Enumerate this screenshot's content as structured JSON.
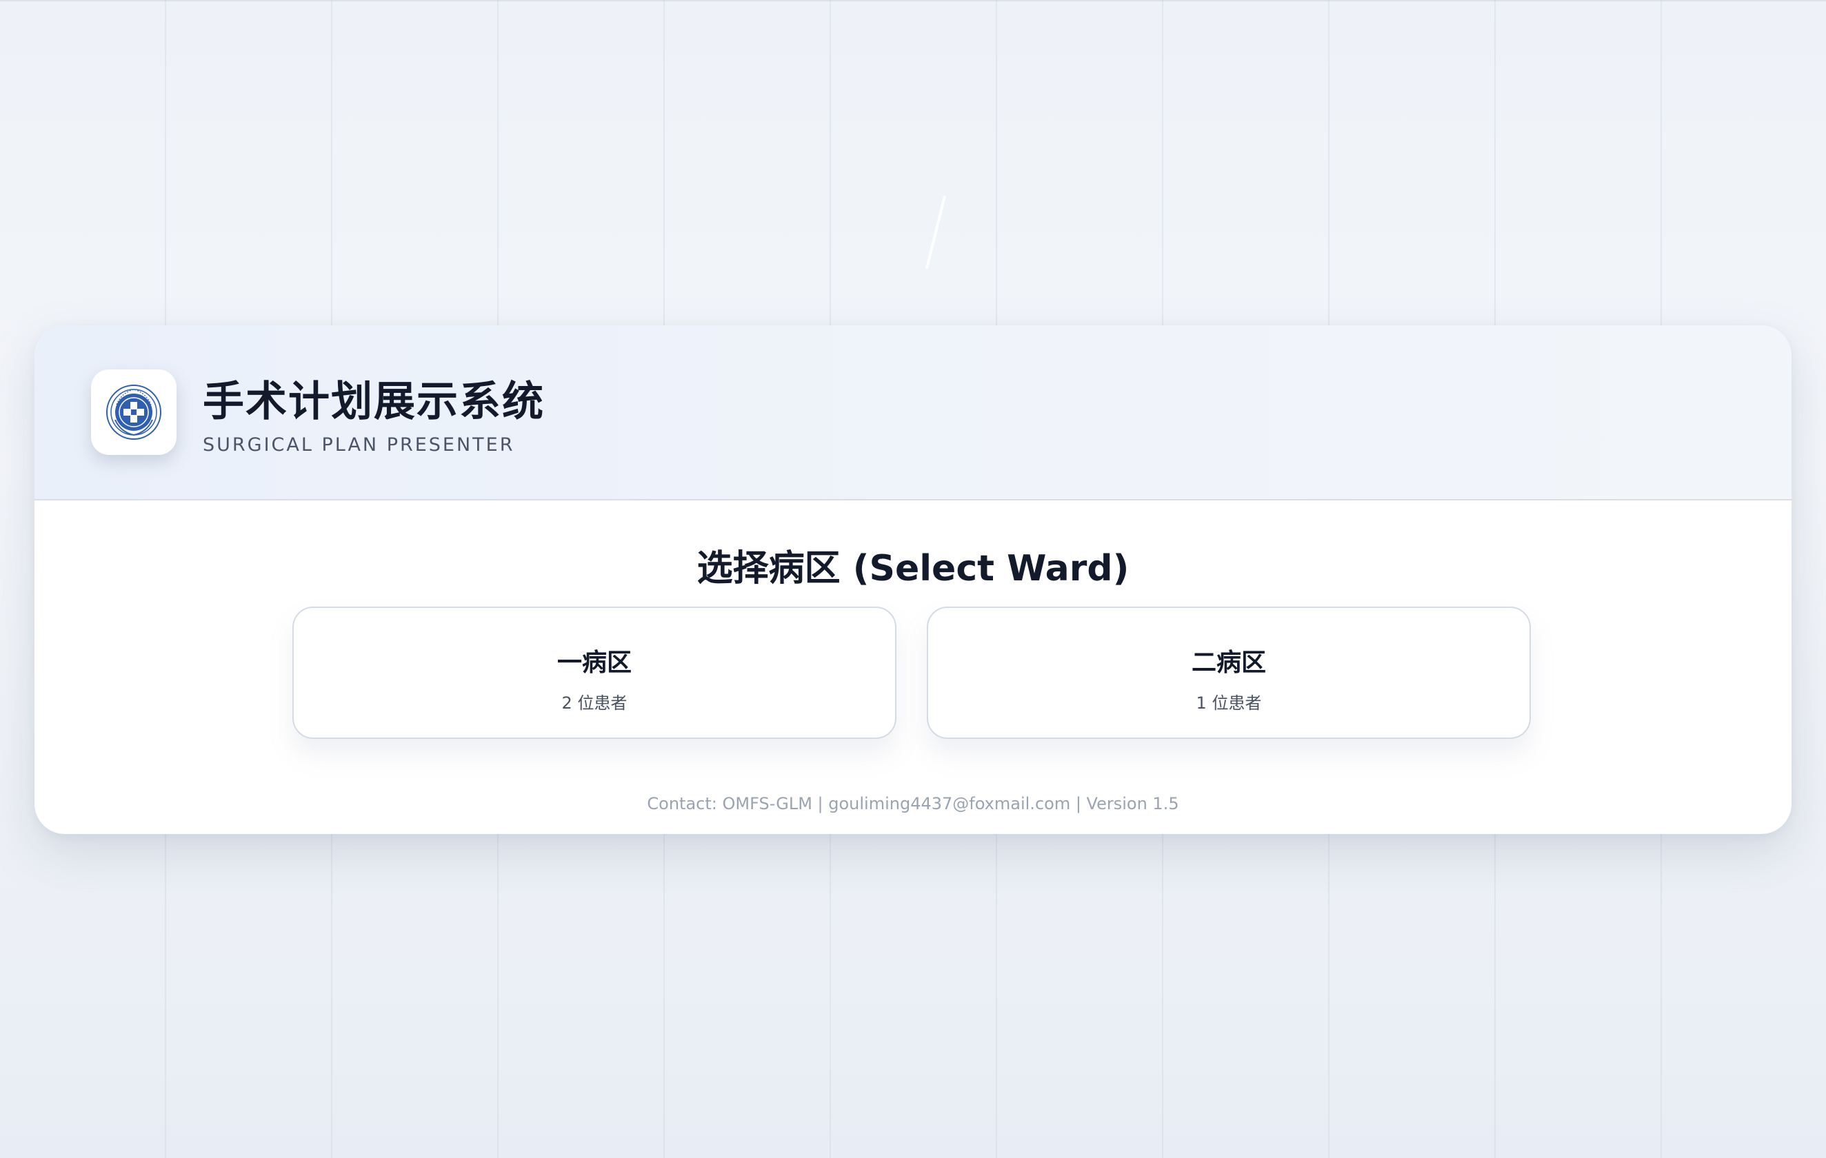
{
  "app": {
    "title": "手术计划展示系统",
    "subtitle": "SURGICAL PLAN PRESENTER",
    "logo_icon": "hospital-emblem-icon"
  },
  "main": {
    "section_title": "选择病区 (Select Ward)",
    "wards": [
      {
        "name": "一病区",
        "count": "2 位患者"
      },
      {
        "name": "二病区",
        "count": "1 位患者"
      }
    ]
  },
  "footer": {
    "text": "Contact: OMFS-GLM | gouliming4437@foxmail.com | Version 1.5"
  },
  "colors": {
    "title": "#121a2b",
    "accent_blue": "#2f5fb3",
    "footer": "#9aa3b2"
  }
}
